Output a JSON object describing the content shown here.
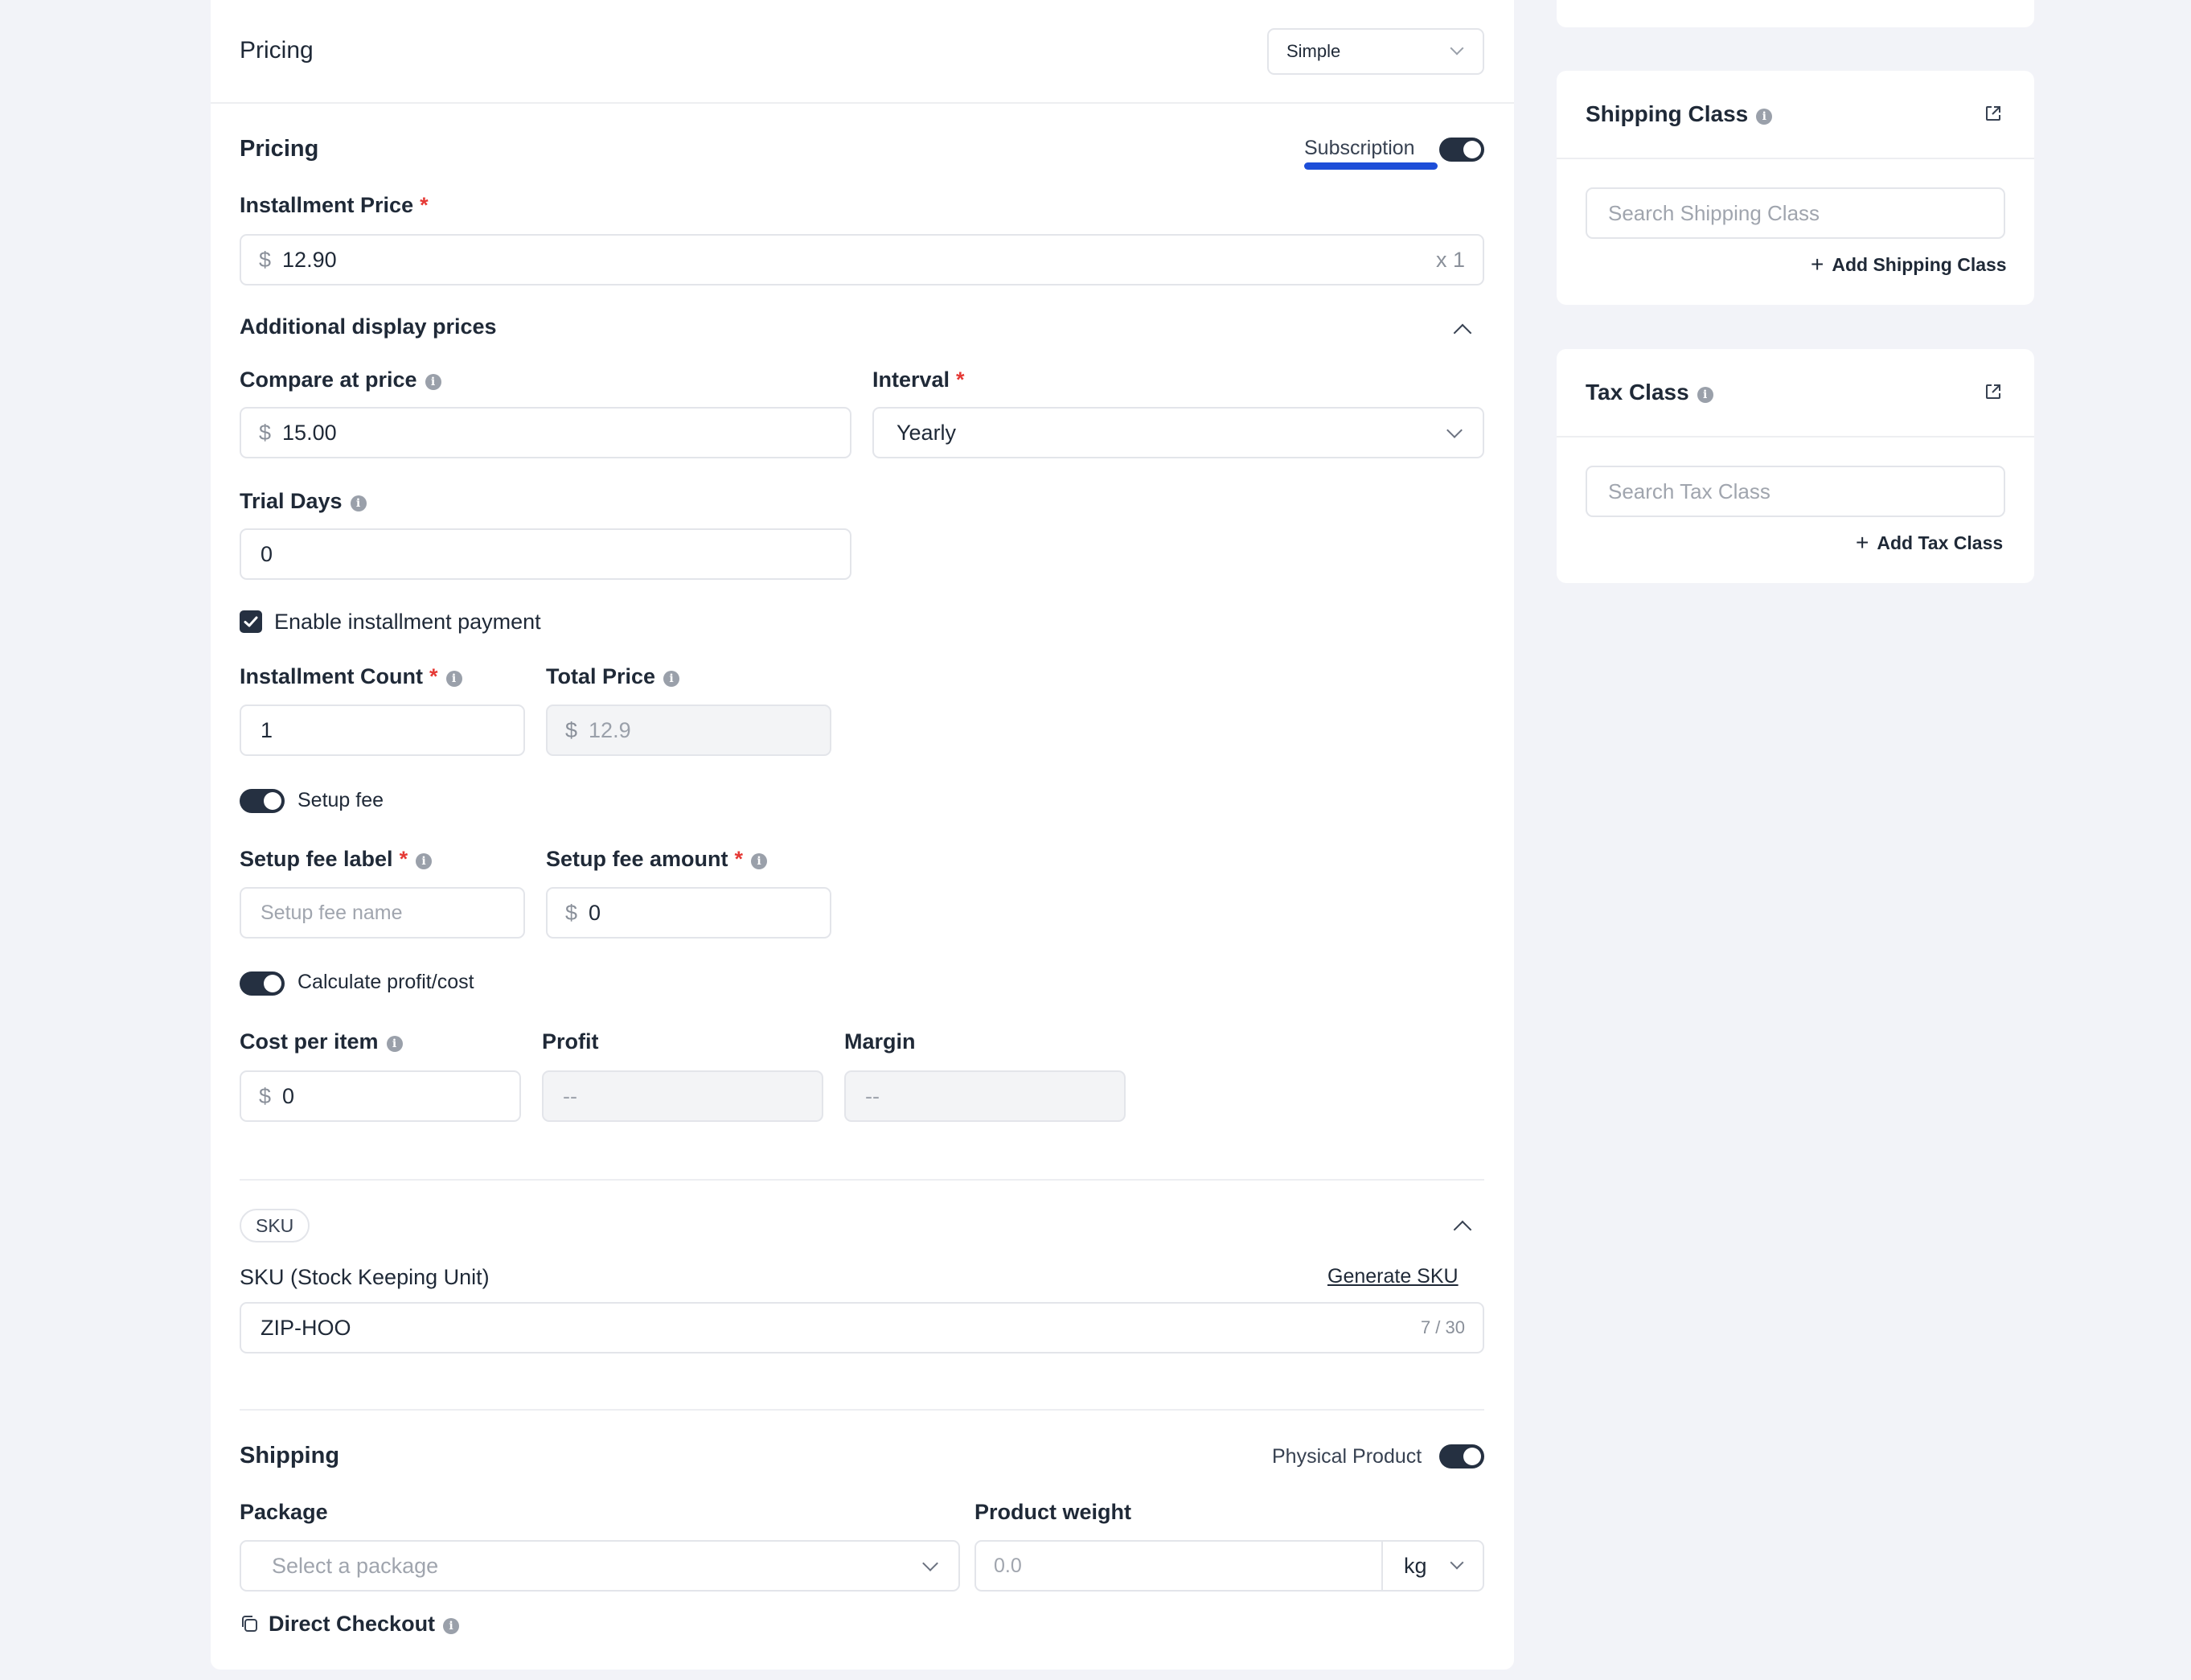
{
  "pricing_header": {
    "title": "Pricing",
    "type_select": "Simple"
  },
  "pricing": {
    "title": "Pricing",
    "subscription_label": "Subscription",
    "installment_price": {
      "label": "Installment Price",
      "required": "*",
      "currency": "$",
      "value": "12.90",
      "suffix": "x 1"
    },
    "additional_display_prices": "Additional display prices",
    "compare_at_price": {
      "label": "Compare at price",
      "currency": "$",
      "value": "15.00"
    },
    "interval": {
      "label": "Interval",
      "required": "*",
      "value": "Yearly"
    },
    "trial_days": {
      "label": "Trial Days",
      "value": "0"
    },
    "enable_installment": {
      "label": "Enable installment payment",
      "checked": true
    },
    "installment_count": {
      "label": "Installment Count",
      "required": "*",
      "value": "1"
    },
    "total_price": {
      "label": "Total Price",
      "currency": "$",
      "value": "12.9"
    },
    "setup_fee": {
      "label": "Setup fee",
      "on": true
    },
    "setup_fee_label": {
      "label": "Setup fee label",
      "required": "*",
      "placeholder": "Setup fee name"
    },
    "setup_fee_amount": {
      "label": "Setup fee amount",
      "required": "*",
      "currency": "$",
      "value": "0"
    },
    "calculate_profit": {
      "label": "Calculate profit/cost",
      "on": true
    },
    "cost_per_item": {
      "label": "Cost per item",
      "currency": "$",
      "value": "0"
    },
    "profit": {
      "label": "Profit",
      "value": "--"
    },
    "margin": {
      "label": "Margin",
      "value": "--"
    }
  },
  "sku": {
    "badge": "SKU",
    "label": "SKU (Stock Keeping Unit)",
    "generate": "Generate SKU",
    "value": "ZIP-HOO",
    "counter": "7 / 30"
  },
  "shipping": {
    "title": "Shipping",
    "physical_label": "Physical Product",
    "package_label": "Package",
    "package_placeholder": "Select a package",
    "weight_label": "Product weight",
    "weight_placeholder": "0.0",
    "weight_unit": "kg",
    "direct_checkout": "Direct Checkout"
  },
  "sidebar": {
    "shipping_class": {
      "title": "Shipping Class",
      "search_placeholder": "Search Shipping Class",
      "add": "Add Shipping Class"
    },
    "tax_class": {
      "title": "Tax Class",
      "search_placeholder": "Search Tax Class",
      "add": "Add Tax Class"
    }
  },
  "colors": {
    "accent_underline": "#1d4ed8",
    "toggle_on": "#253041",
    "required": "#e53935"
  }
}
